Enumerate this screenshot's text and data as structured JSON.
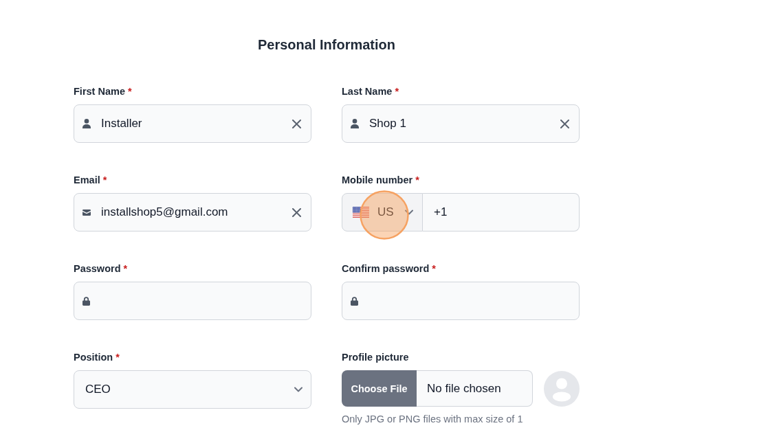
{
  "form": {
    "title": "Personal Information",
    "fields": [
      {
        "kind": "name",
        "label": "First Name",
        "required_mark": "*",
        "value": "Installer",
        "clearable": true
      },
      {
        "kind": "name",
        "label": "Last Name",
        "required_mark": "*",
        "value": "Shop 1",
        "clearable": true
      },
      {
        "kind": "email",
        "label": "Email",
        "required_mark": "*",
        "value": "installshop5@gmail.com",
        "clearable": true
      },
      {
        "kind": "phone",
        "label": "Mobile number",
        "required_mark": "*",
        "country": {
          "code": "US",
          "click_marker": true
        },
        "value": "+1"
      },
      {
        "kind": "password",
        "label": "Password",
        "required_mark": "*",
        "clearable": false
      },
      {
        "kind": "password",
        "label": "Confirm password",
        "required_mark": "*",
        "clearable": false
      },
      {
        "kind": "select",
        "label": "Position",
        "required_mark": "*",
        "value": "CEO"
      },
      {
        "kind": "file",
        "label": "Profile picture",
        "button": "Choose File",
        "status": "No file chosen",
        "hint": "Only JPG or PNG files with max size of 1"
      }
    ]
  }
}
